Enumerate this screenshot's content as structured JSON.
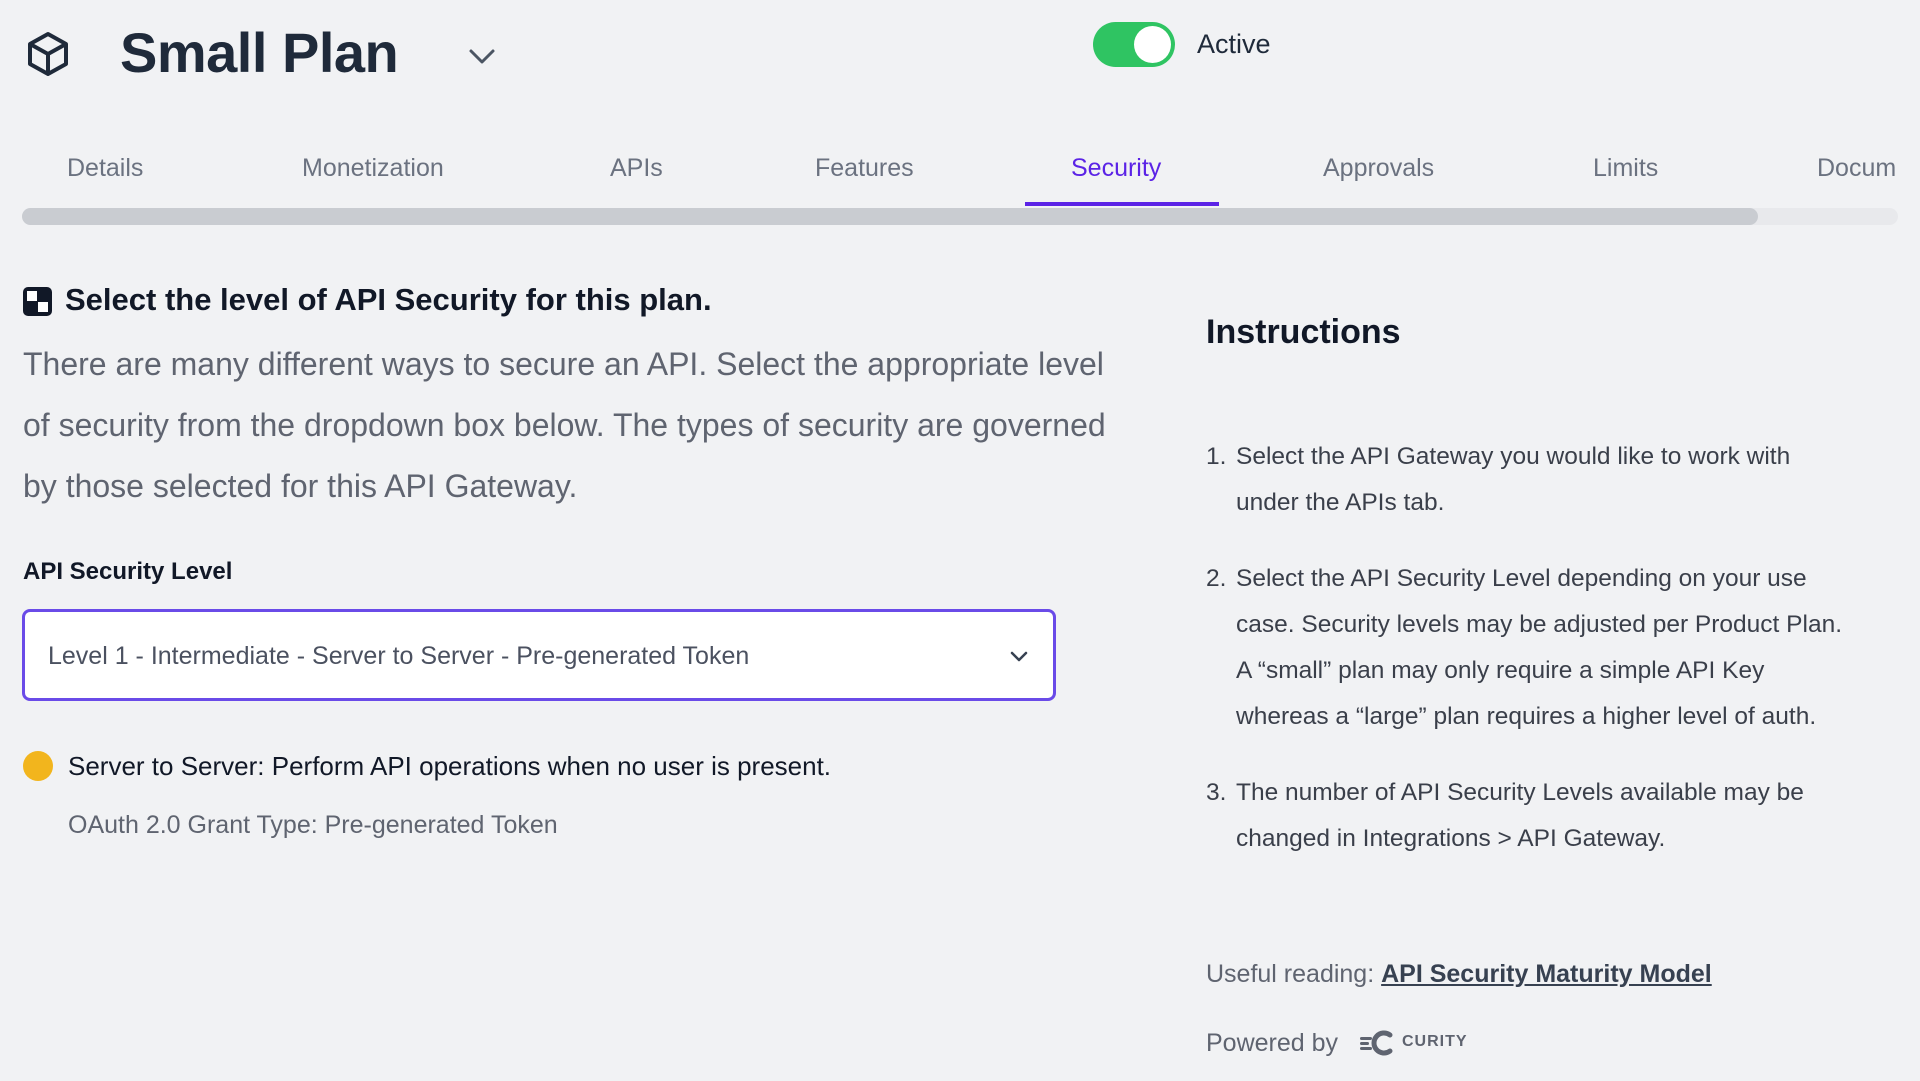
{
  "header": {
    "plan_icon": "cube-icon",
    "title": "Small Plan",
    "title_dropdown_icon": "chevron-down-icon",
    "status_toggle": {
      "state": "on",
      "label": "Active",
      "color": "#2fc462"
    }
  },
  "tabs": {
    "active": "Security",
    "accent_color": "#5b23e6",
    "items": [
      {
        "label": "Details"
      },
      {
        "label": "Monetization"
      },
      {
        "label": "APIs"
      },
      {
        "label": "Features"
      },
      {
        "label": "Security"
      },
      {
        "label": "Approvals"
      },
      {
        "label": "Limits"
      },
      {
        "label": "Docum"
      }
    ]
  },
  "security": {
    "section_icon": "shield-checker-icon",
    "heading": "Select the level of API Security for this plan.",
    "description": "There are many different ways to secure an API. Select the appropriate level of security from the dropdown box below. The types of security are governed by those selected for this API Gateway.",
    "field_label": "API Security Level",
    "selected_level": "Level 1 - Intermediate - Server to Server - Pre-generated Token",
    "select_icon": "chevron-down-icon",
    "status_color": "#f2b51d",
    "info_main": "Server to Server: Perform API operations when no user is present.",
    "info_sub": "OAuth 2.0 Grant Type: Pre-generated Token"
  },
  "instructions": {
    "title": "Instructions",
    "steps": [
      {
        "num": "1.",
        "text": "Select the API Gateway you would like to work with under the APIs tab."
      },
      {
        "num": "2.",
        "text": "Select the API Security Level depending on your use case. Security levels may be adjusted per Product Plan. A “small” plan may only require a simple API Key whereas a “large” plan requires a higher level of auth."
      },
      {
        "num": "3.",
        "text": "The number of API Security Levels available may be changed in Integrations > API Gateway."
      }
    ],
    "useful_reading_label": "Useful reading:",
    "useful_reading_link": "API Security Maturity Model",
    "powered_by_label": "Powered by",
    "powered_by_logo": "curity-logo-icon",
    "powered_by_name": "CURITY"
  }
}
